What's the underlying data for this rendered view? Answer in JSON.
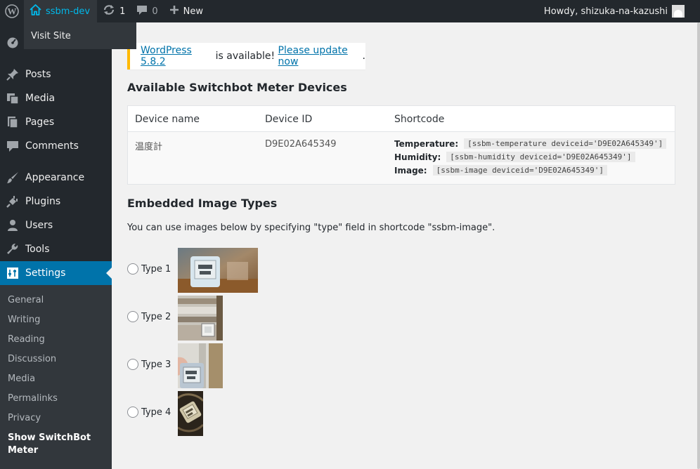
{
  "admin_bar": {
    "site_name": "ssbm-dev",
    "updates_count": "1",
    "comments_count": "0",
    "new_label": "New",
    "greeting": "Howdy, shizuka-na-kazushi",
    "dropdown_item": "Visit Site"
  },
  "sidebar": {
    "items": [
      {
        "label": "Posts",
        "icon": "pin-icon"
      },
      {
        "label": "Media",
        "icon": "media-icon"
      },
      {
        "label": "Pages",
        "icon": "pages-icon"
      },
      {
        "label": "Comments",
        "icon": "comment-icon"
      },
      {
        "label": "Appearance",
        "icon": "brush-icon"
      },
      {
        "label": "Plugins",
        "icon": "plugin-icon"
      },
      {
        "label": "Users",
        "icon": "user-icon"
      },
      {
        "label": "Tools",
        "icon": "wrench-icon"
      },
      {
        "label": "Settings",
        "icon": "sliders-icon"
      }
    ],
    "submenu": [
      "General",
      "Writing",
      "Reading",
      "Discussion",
      "Media",
      "Permalinks",
      "Privacy",
      "Show SwitchBot Meter"
    ]
  },
  "notice": {
    "link1": "WordPress 5.8.2",
    "text": " is available! ",
    "link2": "Please update now",
    "end": "."
  },
  "devices": {
    "heading": "Available Switchbot Meter Devices",
    "columns": [
      "Device name",
      "Device ID",
      "Shortcode"
    ],
    "row": {
      "name": "温度計",
      "id": "D9E02A645349",
      "shortcodes": [
        {
          "label": "Temperature:",
          "code": "[ssbm-temperature deviceid='D9E02A645349']"
        },
        {
          "label": "Humidity:",
          "code": "[ssbm-humidity deviceid='D9E02A645349']"
        },
        {
          "label": "Image:",
          "code": "[ssbm-image deviceid='D9E02A645349']"
        }
      ]
    }
  },
  "image_types": {
    "heading": "Embedded Image Types",
    "description": "You can use images below by specifying \"type\" field in shortcode \"ssbm-image\".",
    "types": [
      "Type 1",
      "Type 2",
      "Type 3",
      "Type 4"
    ]
  },
  "colors": {
    "accent": "#0073aa",
    "sidebar_bg": "#23282d",
    "notice_border": "#ffb900"
  }
}
